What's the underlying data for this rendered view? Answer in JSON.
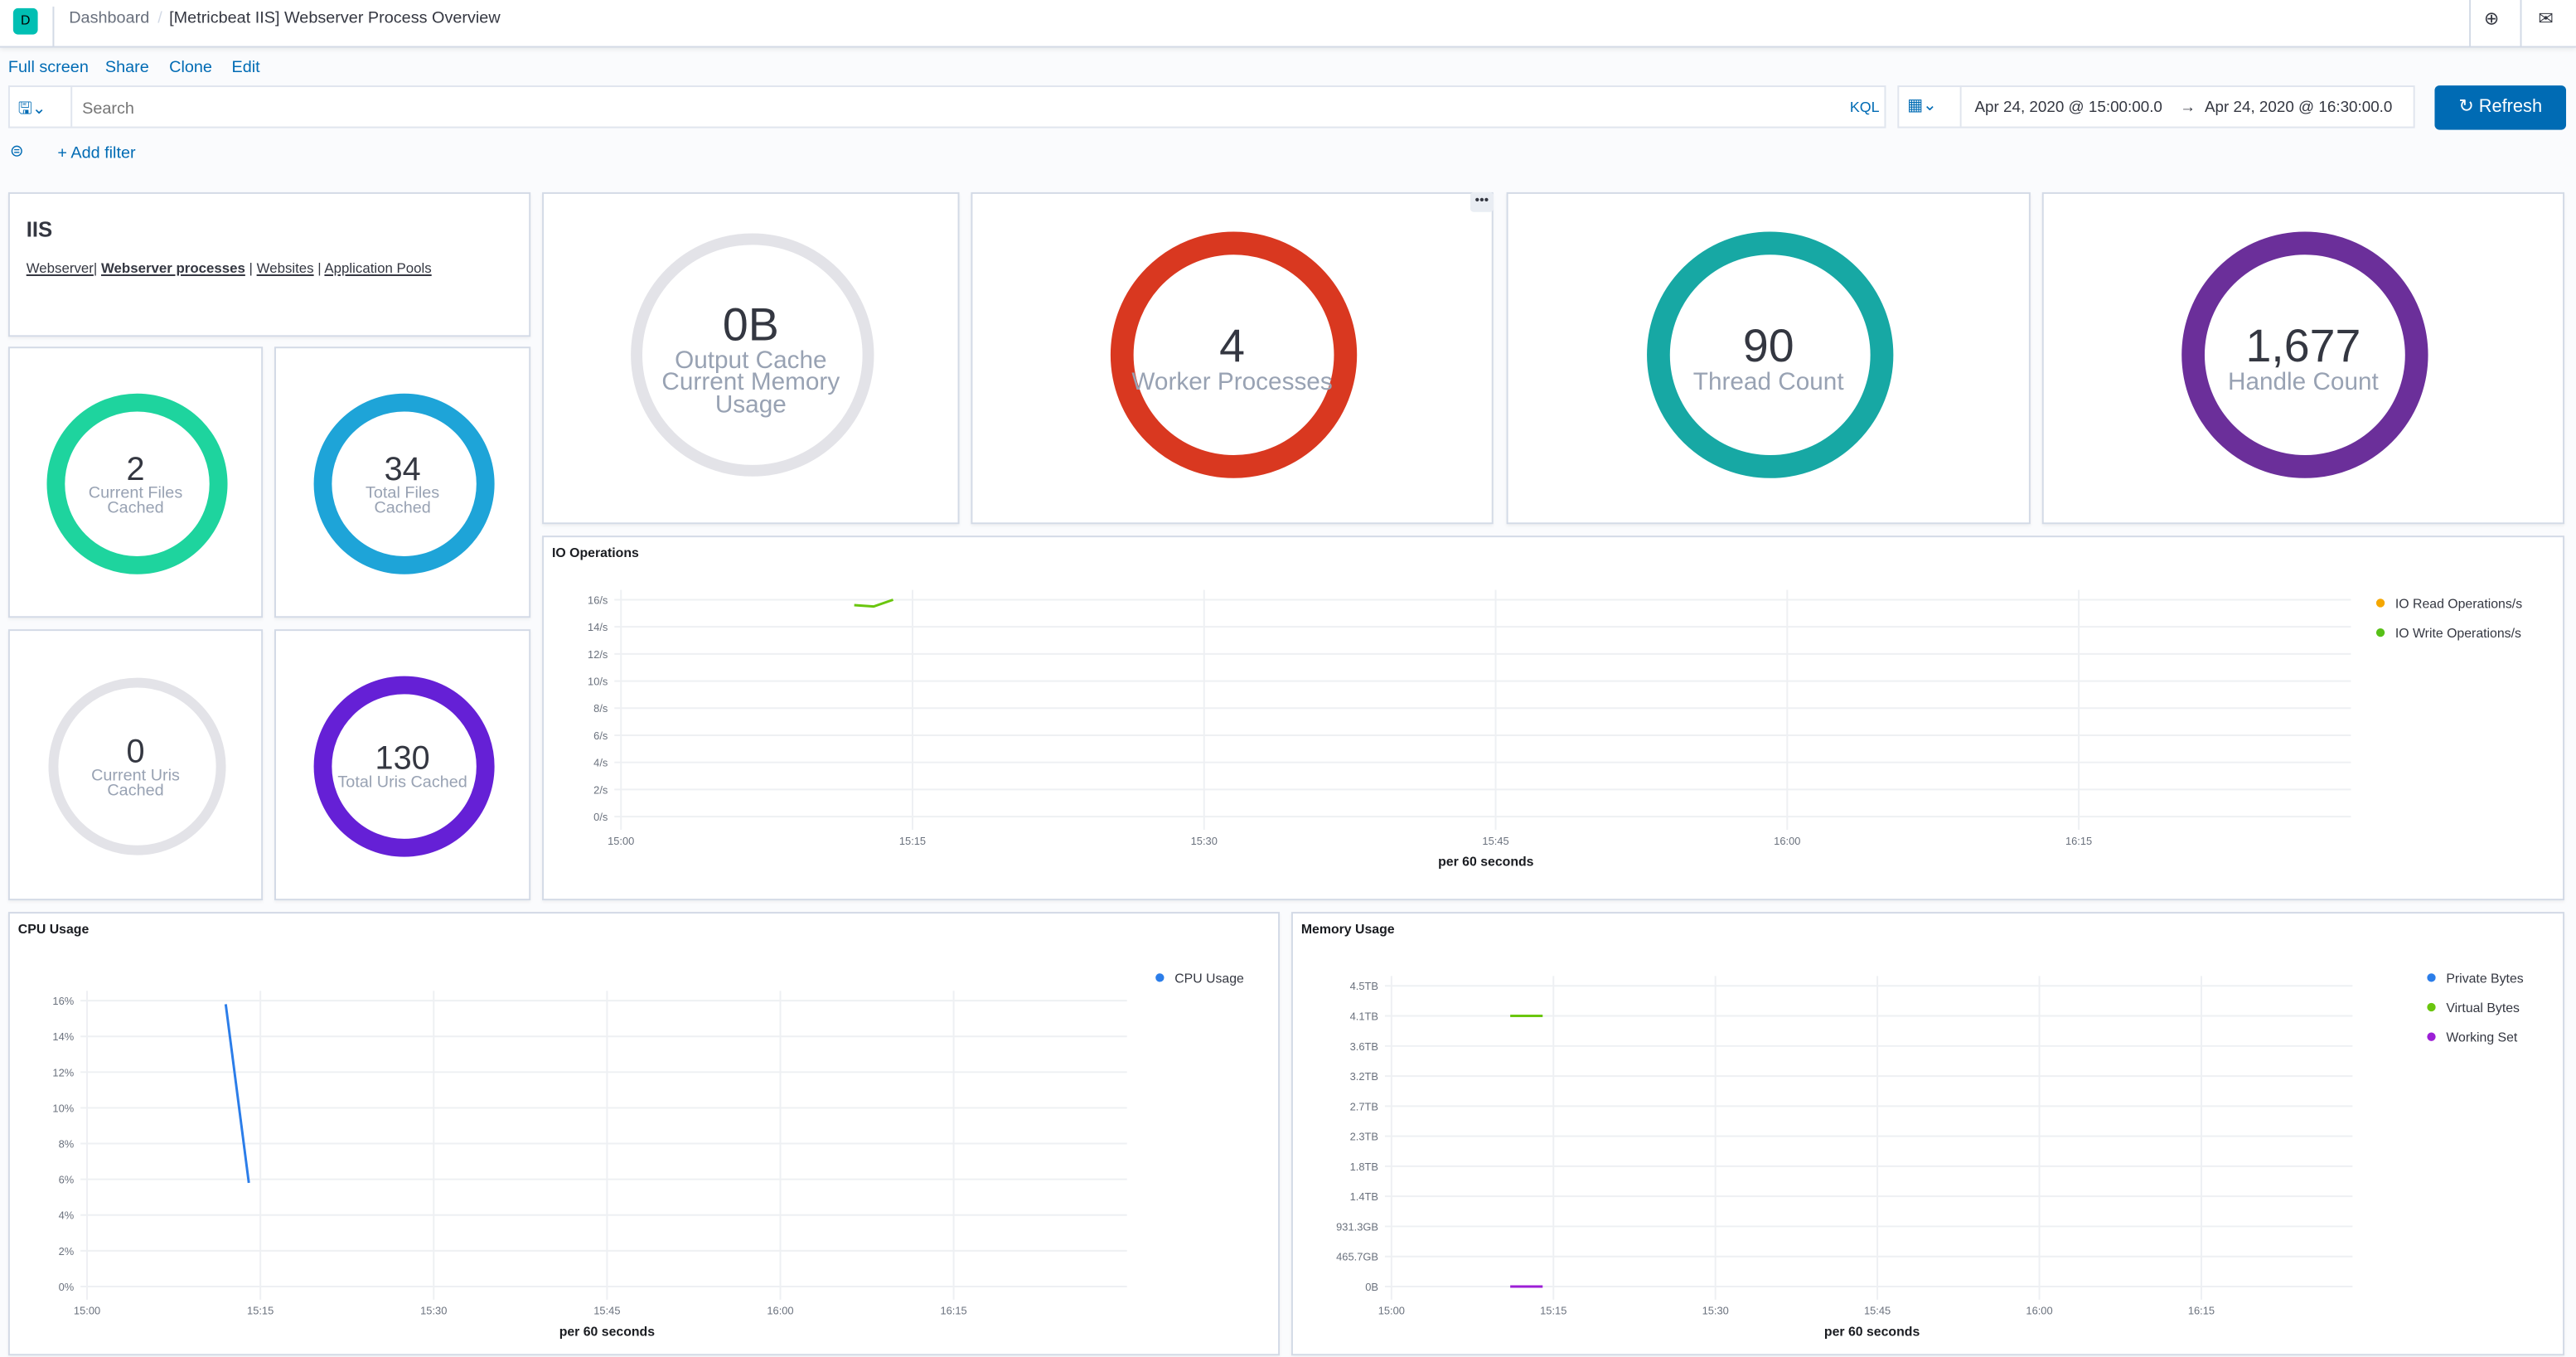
{
  "header": {
    "logo": "D",
    "breadcrumb_root": "Dashboard",
    "title": "[Metricbeat IIS] Webserver Process Overview",
    "icons": [
      "help-icon",
      "mail-icon"
    ]
  },
  "menu": {
    "full_screen": "Full screen",
    "share": "Share",
    "clone": "Clone",
    "edit": "Edit"
  },
  "query": {
    "placeholder": "Search",
    "language": "KQL",
    "date_start": "Apr 24, 2020 @ 15:00:00.0",
    "date_arrow": "→",
    "date_end": "Apr 24, 2020 @ 16:30:00.0",
    "refresh": "Refresh",
    "add_filter": "+ Add filter"
  },
  "iis": {
    "title": "IIS",
    "links": [
      "Webserver",
      "Webserver processes",
      "Websites",
      "Application Pools"
    ],
    "active": "Webserver processes"
  },
  "metrics": {
    "current_files": {
      "value": "2",
      "label1": "Current Files",
      "label2": "Cached",
      "color": "#1ed49e"
    },
    "total_files": {
      "value": "34",
      "label1": "Total Files",
      "label2": "Cached",
      "color": "#1ea4d8"
    },
    "current_uris": {
      "value": "0",
      "label1": "Current Uris",
      "label2": "Cached",
      "color": "#e3e3e8"
    },
    "total_uris": {
      "value": "130",
      "label1": "Total Uris Cached",
      "color": "#6520d6"
    },
    "output_cache": {
      "value": "0B",
      "label1": "Output Cache",
      "label2": "Current Memory",
      "label3": "Usage",
      "color": "#e3e3e8"
    },
    "worker": {
      "value": "4",
      "label1": "Worker Processes",
      "color": "#d93820"
    },
    "threads": {
      "value": "90",
      "label1": "Thread Count",
      "color": "#17a8a4"
    },
    "handles": {
      "value": "1,677",
      "label1": "Handle Count",
      "color": "#6b2f9a"
    }
  },
  "chart_data": [
    {
      "type": "line",
      "title": "IO Operations",
      "xlabel": "per 60 seconds",
      "x_ticks": [
        "15:00",
        "15:15",
        "15:30",
        "15:45",
        "16:00",
        "16:15"
      ],
      "xlim": [
        "15:00",
        "16:29"
      ],
      "y_ticks": [
        "0/s",
        "2/s",
        "4/s",
        "6/s",
        "8/s",
        "10/s",
        "12/s",
        "14/s",
        "16/s"
      ],
      "ylim": [
        0,
        16
      ],
      "grid": true,
      "legend": "right",
      "series": [
        {
          "name": "IO Read Operations/s",
          "color": "#f5a700",
          "x": [],
          "y": []
        },
        {
          "name": "IO Write Operations/s",
          "color": "#54b399",
          "line_color": "#6ac60e",
          "x": [
            "15:12",
            "15:13",
            "15:14"
          ],
          "y": [
            15.6,
            15.5,
            16
          ]
        }
      ]
    },
    {
      "type": "line",
      "title": "CPU Usage",
      "xlabel": "per 60 seconds",
      "x_ticks": [
        "15:00",
        "15:15",
        "15:30",
        "15:45",
        "16:00",
        "16:15"
      ],
      "xlim": [
        "15:00",
        "16:30"
      ],
      "y_ticks": [
        "0%",
        "2%",
        "4%",
        "6%",
        "8%",
        "10%",
        "12%",
        "14%",
        "16%"
      ],
      "ylim": [
        0,
        16
      ],
      "grid": true,
      "legend": "right",
      "series": [
        {
          "name": "CPU Usage",
          "color": "#2b7de9",
          "x": [
            "15:12",
            "15:14"
          ],
          "y": [
            15.8,
            5.8
          ]
        }
      ]
    },
    {
      "type": "line",
      "title": "Memory Usage",
      "xlabel": "per 60 seconds",
      "x_ticks": [
        "15:00",
        "15:15",
        "15:30",
        "15:45",
        "16:00",
        "16:15"
      ],
      "xlim": [
        "15:00",
        "16:29"
      ],
      "y_ticks": [
        "0B",
        "465.7GB",
        "931.3GB",
        "1.4TB",
        "1.8TB",
        "2.3TB",
        "2.7TB",
        "3.2TB",
        "3.6TB",
        "4.1TB",
        "4.5TB"
      ],
      "ylim": [
        0,
        4.5
      ],
      "grid": true,
      "legend": "right",
      "series": [
        {
          "name": "Private Bytes",
          "color": "#2b7de9",
          "x": [],
          "y": []
        },
        {
          "name": "Virtual Bytes",
          "color": "#6ac60e",
          "x": [
            "15:11",
            "15:14"
          ],
          "y": [
            4.05,
            4.05
          ]
        },
        {
          "name": "Working Set",
          "color": "#9c1fd6",
          "x": [
            "15:11",
            "15:14"
          ],
          "y": [
            0,
            0
          ]
        }
      ]
    }
  ]
}
